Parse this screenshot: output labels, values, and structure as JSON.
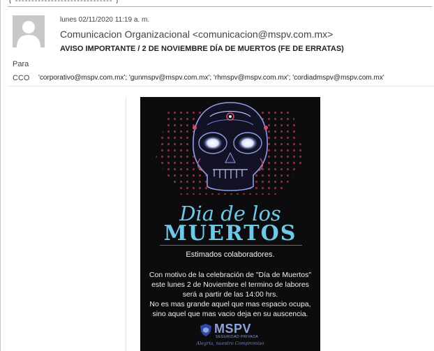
{
  "header": {
    "date": "lunes 02/11/2020 11:19 a. m.",
    "sender": "Comunicacion Organizacional <comunicacion@mspv.com.mx>",
    "subject": "AVISO IMPORTANTE / 2 DE NOVIEMBRE DÍA DE MUERTOS (FE DE ERRATAS)",
    "avatar_icon": "person-silhouette-icon"
  },
  "recipients": {
    "to_label": "Para",
    "cco_label": "CCO",
    "cco_values": "'corporativo@mspv.com.mx'; 'gunmspv@mspv.com.mx'; 'rhmspv@mspv.com.mx'; 'cordiadmspv@mspv.com.mx'"
  },
  "poster": {
    "title_script": "Dia de los",
    "title_main": "MUERTOS",
    "greeting": "Estimados colaboradores.",
    "message_lines": [
      "Con motivo de la celebración de \"Día de Muertos\"",
      "este lunes 2 de Noviembre el termino de labores",
      "será a partir de las 14:00 hrs.",
      "No es mas grande aquel que mas espacio ocupa,",
      "sino aquel que mas vacio deja en su auscencia."
    ],
    "logo_text": "MSPV",
    "logo_subtext": "SEGURIDAD PRIVADA",
    "tagline": "Alegría, nuestro Compromiso",
    "colors": {
      "background": "#0c0c0e",
      "title": "#6ec9e6",
      "rule": "#b24a57",
      "logo": "#8da3d9"
    }
  }
}
